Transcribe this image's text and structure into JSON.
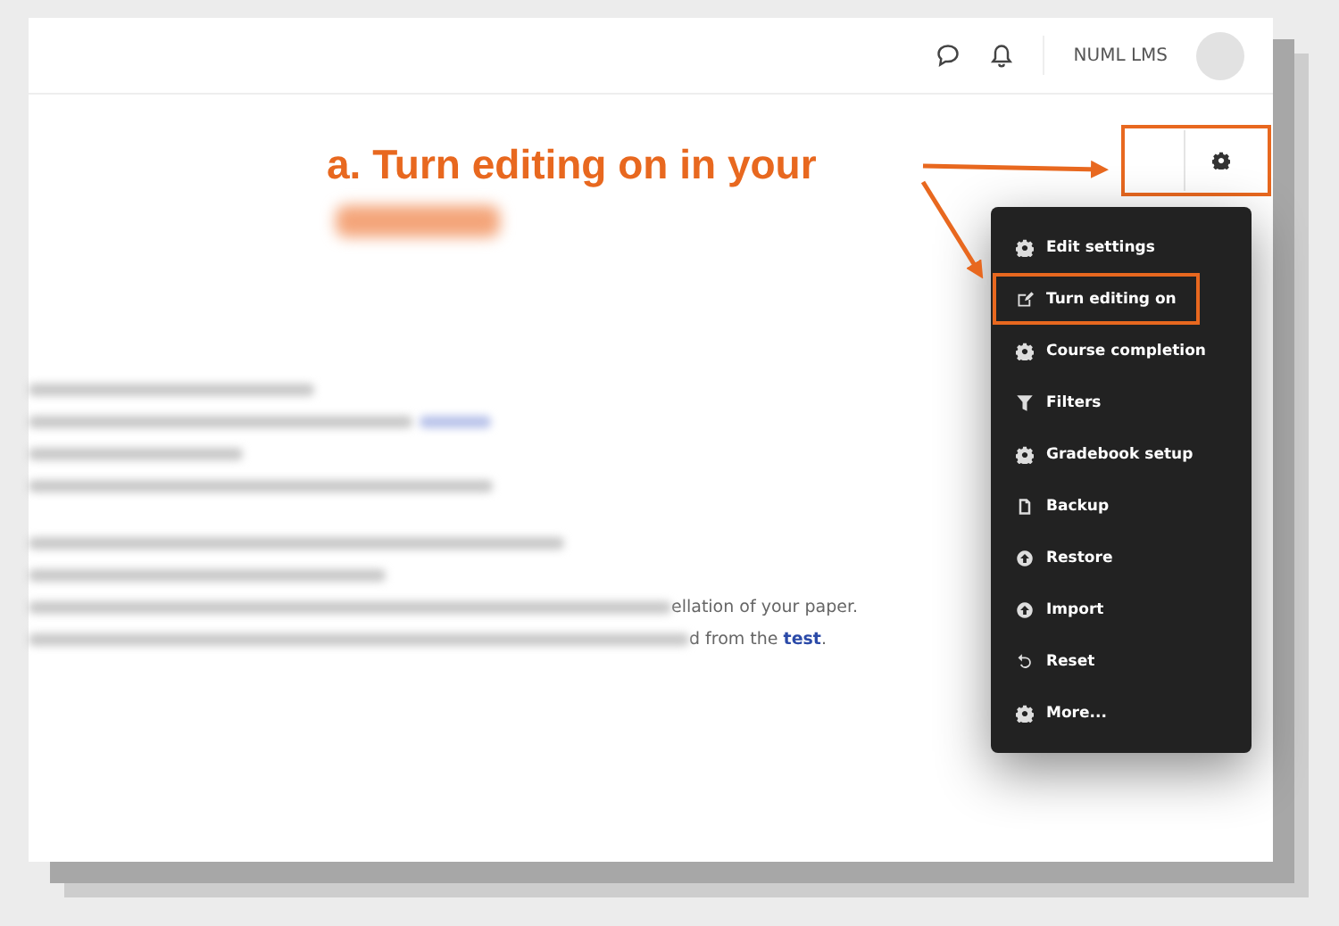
{
  "header": {
    "site_name": "NUML LMS"
  },
  "annotation": {
    "text": "a. Turn editing on in your"
  },
  "menu": {
    "items": [
      {
        "label": "Edit settings",
        "kind": "gear",
        "highlighted": false
      },
      {
        "label": "Turn editing on",
        "kind": "edit",
        "highlighted": true
      },
      {
        "label": "Course completion",
        "kind": "gear",
        "highlighted": false
      },
      {
        "label": "Filters",
        "kind": "filter",
        "highlighted": false
      },
      {
        "label": "Gradebook setup",
        "kind": "gear",
        "highlighted": false
      },
      {
        "label": "Backup",
        "kind": "file",
        "highlighted": false
      },
      {
        "label": "Restore",
        "kind": "up",
        "highlighted": false
      },
      {
        "label": "Import",
        "kind": "up",
        "highlighted": false
      },
      {
        "label": "Reset",
        "kind": "undo",
        "highlighted": false
      },
      {
        "label": "More...",
        "kind": "gear",
        "highlighted": false
      }
    ]
  },
  "content": {
    "lines": [
      {
        "text": "ellation of your paper."
      },
      {
        "text": "d from the ",
        "link": "test",
        "after": "."
      }
    ]
  }
}
